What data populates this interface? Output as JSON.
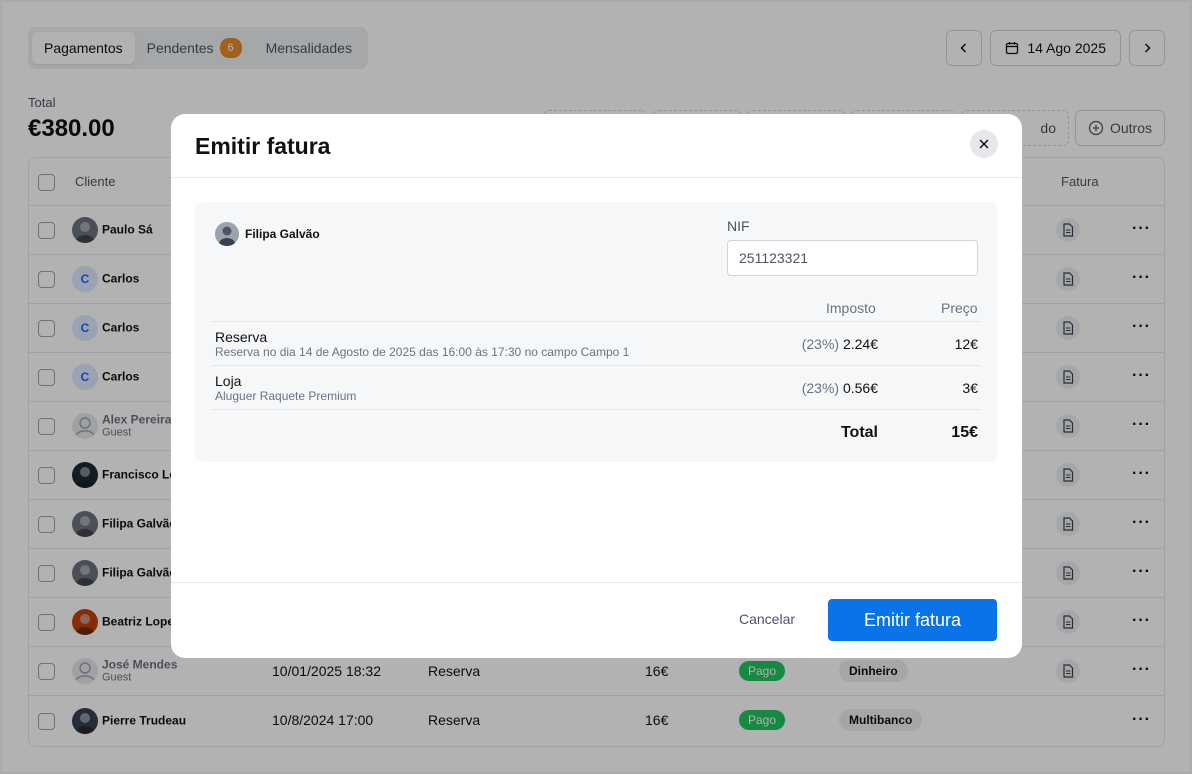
{
  "tabs": [
    {
      "label": "Pagamentos",
      "active": true
    },
    {
      "label": "Pendentes",
      "badge": "6"
    },
    {
      "label": "Mensalidades"
    }
  ],
  "date_nav": {
    "date": "14 Ago 2025",
    "prev_icon": "chevron-left-icon",
    "next_icon": "chevron-right-icon",
    "calendar_icon": "calendar-icon"
  },
  "summary": {
    "label": "Total",
    "value": "€380.00"
  },
  "filters": {
    "partial": "do",
    "outros": "Outros"
  },
  "table": {
    "headers": {
      "cliente": "Cliente",
      "fatura": "Fatura"
    },
    "rows": [
      {
        "name": "Paulo Sá",
        "avatar": "photo",
        "color": "#6b7280"
      },
      {
        "name": "Carlos",
        "avatar": "letter",
        "initial": "C"
      },
      {
        "name": "Carlos",
        "avatar": "letter",
        "initial": "C"
      },
      {
        "name": "Carlos",
        "avatar": "letter",
        "initial": "C"
      },
      {
        "name": "Alex Pereira",
        "sub": "Guest",
        "avatar": "guest"
      },
      {
        "name": "Francisco Lo",
        "avatar": "photo",
        "color": "#1f2937"
      },
      {
        "name": "Filipa Galvão",
        "avatar": "photo",
        "color": "#6b7280"
      },
      {
        "name": "Filipa Galvão",
        "avatar": "photo",
        "color": "#6b7280"
      },
      {
        "name": "Beatriz Lope",
        "avatar": "photo",
        "color": "#c2410c"
      },
      {
        "name": "José Mendes",
        "sub": "Guest",
        "avatar": "guest",
        "date": "10/01/2025 18:32",
        "type": "Reserva",
        "amount": "16€",
        "status": "Pago",
        "method": "Dinheiro",
        "invoice": true
      },
      {
        "name": "Pierre Trudeau",
        "avatar": "photo",
        "color": "#374151",
        "date": "10/8/2024 17:00",
        "type": "Reserva",
        "amount": "16€",
        "status": "Pago",
        "method": "Multibanco",
        "invoice": false
      }
    ]
  },
  "modal": {
    "title": "Emitir fatura",
    "client": "Filipa Galvão",
    "nif_label": "NIF",
    "nif_value": "251123321",
    "headers": {
      "imposto": "Imposto",
      "preco": "Preço"
    },
    "items": [
      {
        "name": "Reserva",
        "desc": "Reserva no dia 14 de Agosto de 2025 das 16:00 às 17:30 no campo Campo 1",
        "tax_pct": "(23%)",
        "tax": "2.24€",
        "price": "12€"
      },
      {
        "name": "Loja",
        "desc": "Aluguer Raquete Premium",
        "tax_pct": "(23%)",
        "tax": "0.56€",
        "price": "3€"
      }
    ],
    "total_label": "Total",
    "total_value": "15€",
    "cancel": "Cancelar",
    "submit": "Emitir fatura"
  }
}
